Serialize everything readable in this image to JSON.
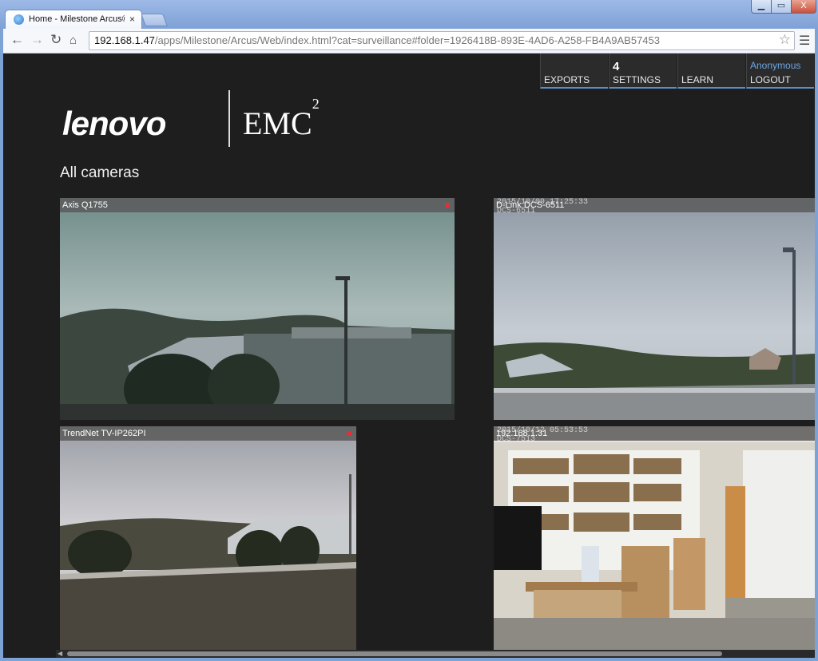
{
  "browser": {
    "tab_title": "Home - Milestone Arcus®",
    "tab_close": "×",
    "url_host": "192.168.1.47",
    "url_path": "/apps/Milestone/Arcus/Web/index.html?cat=surveillance#folder=1926418B-893E-4AD6-A258-FB4A9AB57453",
    "window_buttons": [
      "▁",
      "▭",
      "X"
    ]
  },
  "nav": {
    "exports": "EXPORTS",
    "settings": "SETTINGS",
    "settings_count": "4",
    "learn": "LEARN",
    "user": "Anonymous",
    "logout": "LOGOUT"
  },
  "logos": {
    "lenovo": "lenovo",
    "emc": "EMC",
    "emc_sup": "2"
  },
  "page_title": "All cameras",
  "cameras": [
    {
      "name": "Axis Q1755",
      "recording": true,
      "overlay": ""
    },
    {
      "name": "D-Link DCS-6511",
      "recording": false,
      "overlay": "2015/10/09 17:25:33\nDCS-6511"
    },
    {
      "name": "TrendNet TV-IP262PI",
      "recording": true,
      "overlay": ""
    },
    {
      "name": "192.168.1.31",
      "recording": false,
      "overlay": "2015/10/12 05:53:53\nDCS-7513"
    }
  ],
  "colors": {
    "accent": "#5b8fc9",
    "page_bg": "#1e1e1e",
    "rec": "#e0303a"
  },
  "icons": {
    "back": "back-arrow-icon",
    "forward": "forward-arrow-icon",
    "reload": "reload-icon",
    "home": "home-icon",
    "bookmark": "star-icon",
    "menu": "hamburger-menu-icon"
  }
}
